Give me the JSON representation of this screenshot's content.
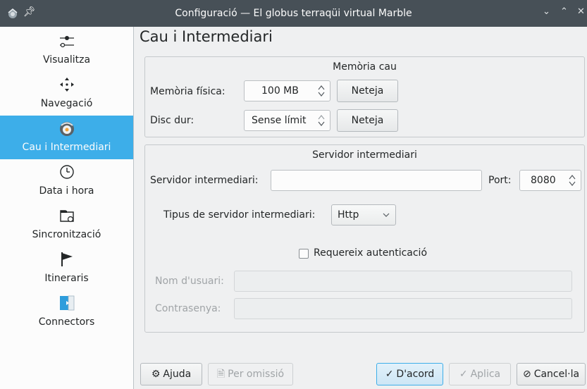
{
  "window": {
    "title": "Configuració — El globus terraqüi virtual Marble"
  },
  "sidebar": {
    "items": [
      {
        "label": "Visualitza",
        "icon": "sliders-icon"
      },
      {
        "label": "Navegació",
        "icon": "move-arrows-icon"
      },
      {
        "label": "Cau i Intermediari",
        "icon": "marble-globe-icon",
        "selected": true
      },
      {
        "label": "Data i hora",
        "icon": "clock-icon"
      },
      {
        "label": "Sincronització",
        "icon": "folder-sync-icon"
      },
      {
        "label": "Itineraris",
        "icon": "flag-icon"
      },
      {
        "label": "Connectors",
        "icon": "plugin-icon"
      }
    ]
  },
  "page": {
    "title": "Cau i Intermediari"
  },
  "cache": {
    "group_title": "Memòria cau",
    "physical_label": "Memòria física:",
    "physical_value": "100 MB",
    "physical_clear": "Neteja",
    "disk_label": "Disc dur:",
    "disk_value": "Sense límit",
    "disk_clear": "Neteja"
  },
  "proxy": {
    "group_title": "Servidor intermediari",
    "server_label": "Servidor intermediari:",
    "server_value": "",
    "port_label": "Port:",
    "port_value": "8080",
    "type_label": "Tipus de servidor intermediari:",
    "type_value": "Http",
    "auth_label": "Requereix autenticació",
    "auth_checked": false,
    "user_label": "Nom d'usuari:",
    "password_label": "Contrasenya:"
  },
  "footer": {
    "help": "Ajuda",
    "defaults": "Per omissió",
    "ok": "D'acord",
    "apply": "Aplica",
    "cancel": "Cancel·la"
  },
  "colors": {
    "accent": "#3daee9",
    "titlebar": "#475057",
    "window_bg": "#eff0f1"
  }
}
